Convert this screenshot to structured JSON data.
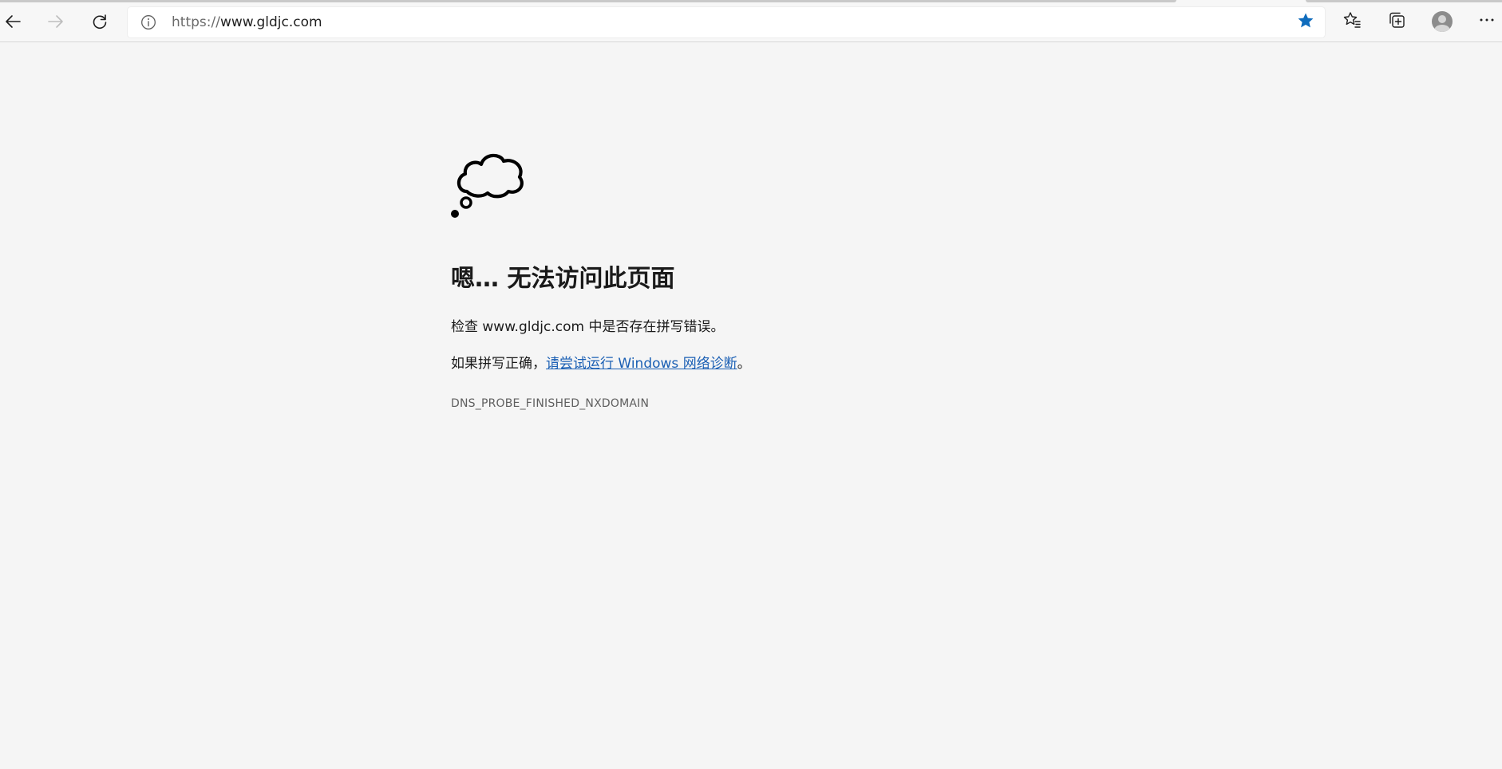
{
  "browser": {
    "url_scheme": "https://",
    "url_host": "www.gldjc.com",
    "icons": {
      "back": "arrow-left-icon",
      "forward": "arrow-right-icon",
      "refresh": "refresh-icon",
      "site_info": "info-icon",
      "favorite": "star-filled-icon",
      "favorites_list": "favorites-icon",
      "collections": "collections-icon",
      "profile": "avatar-icon",
      "menu": "ellipsis-icon"
    },
    "accent_color": "#0f6cbd"
  },
  "error_page": {
    "icon": "thought-cloud-icon",
    "title": "嗯… 无法访问此页面",
    "check_prefix": "检查 ",
    "check_host": "www.gldjc.com",
    "check_suffix": " 中是否存在拼写错误。",
    "spelled_prefix": "如果拼写正确，",
    "diagnostics_link": "请尝试运行 Windows 网络诊断",
    "spelled_suffix": "。",
    "error_code": "DNS_PROBE_FINISHED_NXDOMAIN",
    "link_color": "#1a5fb4"
  }
}
